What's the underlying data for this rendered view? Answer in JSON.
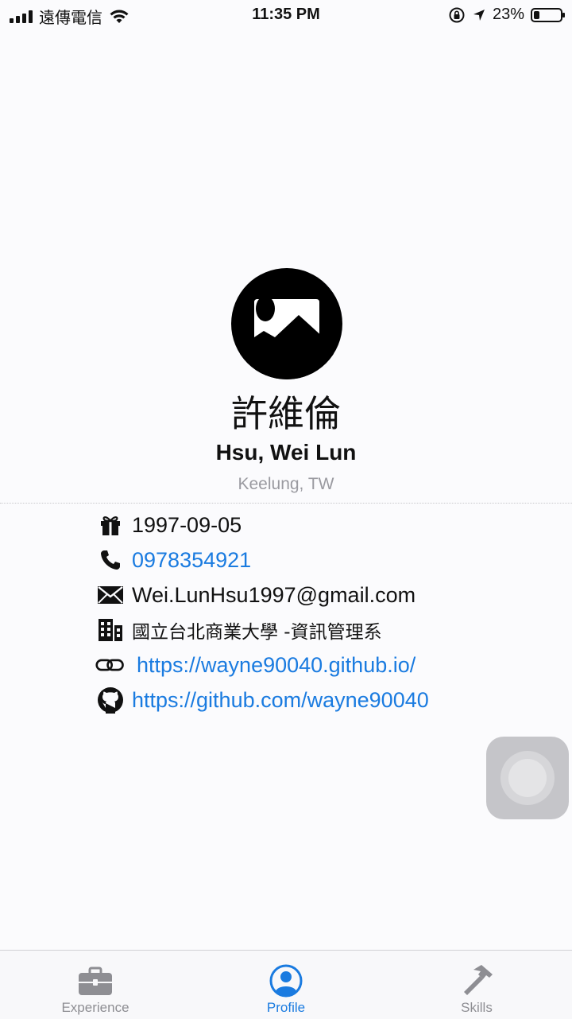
{
  "status_bar": {
    "carrier": "遠傳電信",
    "time": "11:35 PM",
    "battery_percent": "23%",
    "battery_level": 0.23
  },
  "profile": {
    "avatar_icon": "photo-placeholder-icon",
    "name_zh": "許維倫",
    "name_en": "Hsu, Wei Lun",
    "location": "Keelung, TW"
  },
  "info": {
    "birthday": "1997-09-05",
    "phone": "0978354921",
    "email": "Wei.LunHsu1997@gmail.com",
    "school": "國立台北商業大學 -資訊管理系",
    "website": "https://wayne90040.github.io/",
    "github": "https://github.com/wayne90040"
  },
  "tabs": [
    {
      "label": "Experience",
      "icon": "briefcase-icon",
      "active": false
    },
    {
      "label": "Profile",
      "icon": "person-circle-icon",
      "active": true
    },
    {
      "label": "Skills",
      "icon": "hammer-icon",
      "active": false
    }
  ],
  "colors": {
    "accent": "#1a7be0",
    "inactive": "#8e8e93",
    "background": "#fbfbfd"
  }
}
